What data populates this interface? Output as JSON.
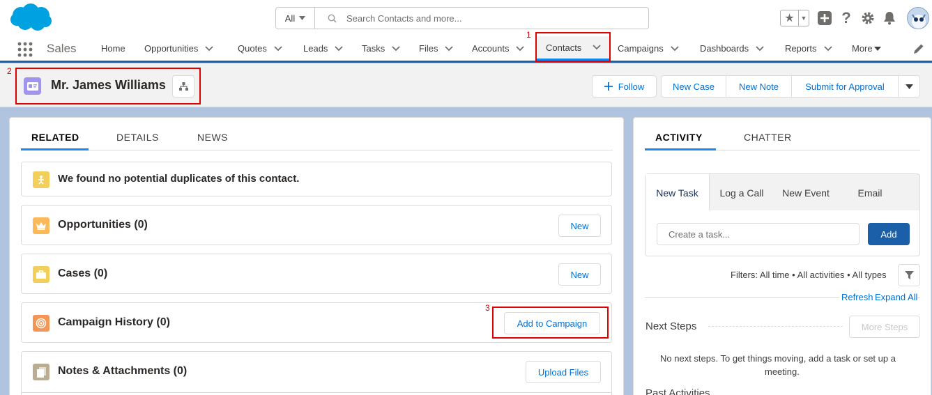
{
  "app": {
    "name": "Sales"
  },
  "search": {
    "scope": "All",
    "placeholder": "Search Contacts and more..."
  },
  "nav": {
    "items": [
      {
        "label": "Home",
        "has_menu": false
      },
      {
        "label": "Opportunities",
        "has_menu": true
      },
      {
        "label": "Quotes",
        "has_menu": true
      },
      {
        "label": "Leads",
        "has_menu": true
      },
      {
        "label": "Tasks",
        "has_menu": true
      },
      {
        "label": "Files",
        "has_menu": true
      },
      {
        "label": "Accounts",
        "has_menu": true
      },
      {
        "label": "Contacts",
        "has_menu": true,
        "active": true
      },
      {
        "label": "Campaigns",
        "has_menu": true
      },
      {
        "label": "Dashboards",
        "has_menu": true
      },
      {
        "label": "Reports",
        "has_menu": true
      },
      {
        "label": "More",
        "has_menu": true
      }
    ]
  },
  "record": {
    "name": "Mr. James Williams",
    "buttons": {
      "follow": "Follow",
      "new_case": "New Case",
      "new_note": "New Note",
      "submit": "Submit for Approval"
    }
  },
  "main_tabs": [
    "RELATED",
    "DETAILS",
    "NEWS"
  ],
  "related": {
    "duplicates": "We found no potential duplicates of this contact.",
    "opportunities": {
      "title": "Opportunities (0)",
      "button": "New"
    },
    "cases": {
      "title": "Cases (0)",
      "button": "New"
    },
    "campaigns": {
      "title": "Campaign History (0)",
      "button": "Add to Campaign"
    },
    "notes": {
      "title": "Notes & Attachments (0)",
      "button": "Upload Files"
    }
  },
  "side_tabs": [
    "ACTIVITY",
    "CHATTER"
  ],
  "activity": {
    "tabs": [
      "New Task",
      "Log a Call",
      "New Event",
      "Email"
    ],
    "task_placeholder": "Create a task...",
    "add_label": "Add",
    "filters": "Filters: All time • All activities • All types",
    "refresh": "Refresh",
    "expand_all": "Expand All",
    "next_steps": "Next Steps",
    "more_steps": "More Steps",
    "empty_message_line1": "No next steps. To get things moving, add a task or set up a",
    "empty_message_line2": "meeting.",
    "past_activities": "Past Activities"
  },
  "annotations": [
    "1",
    "2",
    "3"
  ],
  "colors": {
    "brand": "#1b5fa8",
    "link": "#0070d2",
    "highlight": "#e00000",
    "contact_icon": "#a094ed",
    "opportunity_icon": "#fcb95b",
    "case_icon": "#f2cf5b",
    "campaign_icon": "#f49756",
    "note_icon": "#baac93"
  }
}
